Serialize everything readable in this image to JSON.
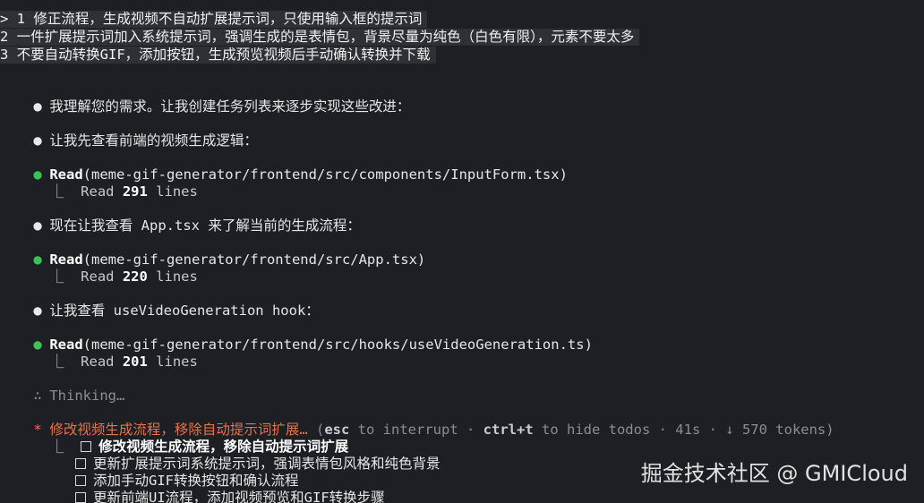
{
  "prompt": {
    "lines": [
      "> 1 修正流程，生成视频不自动扩展提示词，只使用输入框的提示词",
      "2 一件扩展提示词加入系统提示词，强调生成的是表情包，背景尽量为纯色（白色有限），元素不要太多",
      "3 不要自动转换GIF，添加按钮，生成预览视频后手动确认转换并下载"
    ]
  },
  "messages": {
    "m1": "我理解您的需求。让我创建任务列表来逐步实现这些改进：",
    "m2": "让我先查看前端的视频生成逻辑：",
    "read1_tool": "Read",
    "read1_path": "(meme-gif-generator/frontend/src/components/InputForm.tsx)",
    "read1_prefix": "Read ",
    "read1_count": "291",
    "read1_suffix": " lines",
    "m3": "现在让我查看 App.tsx 来了解当前的生成流程：",
    "read2_tool": "Read",
    "read2_path": "(meme-gif-generator/frontend/src/App.tsx)",
    "read2_prefix": "Read ",
    "read2_count": "220",
    "read2_suffix": " lines",
    "m4": "让我查看 useVideoGeneration hook：",
    "read3_tool": "Read",
    "read3_path": "(meme-gif-generator/frontend/src/hooks/useVideoGeneration.ts)",
    "read3_prefix": "Read ",
    "read3_count": "201",
    "read3_suffix": " lines",
    "thinking_symbol": "∴",
    "thinking": "Thinking…"
  },
  "status": {
    "spinner": "*",
    "task": "修改视频生成流程，移除自动提示词扩展…",
    "paren_open": " (",
    "esc": "esc",
    "esc_text": " to interrupt · ",
    "ctrl": "ctrl+t",
    "ctrl_text": " to hide todos · 41s · ↓ 570 tokens)"
  },
  "todos": [
    "修改视频生成流程，移除自动提示词扩展",
    "更新扩展提示词系统提示词，强调表情包风格和纯色背景",
    "添加手动GIF转换按钮和确认流程",
    "更新前端UI流程，添加视频预览和GIF转换步骤"
  ],
  "watermark": "掘金技术社区 @ GMICloud"
}
